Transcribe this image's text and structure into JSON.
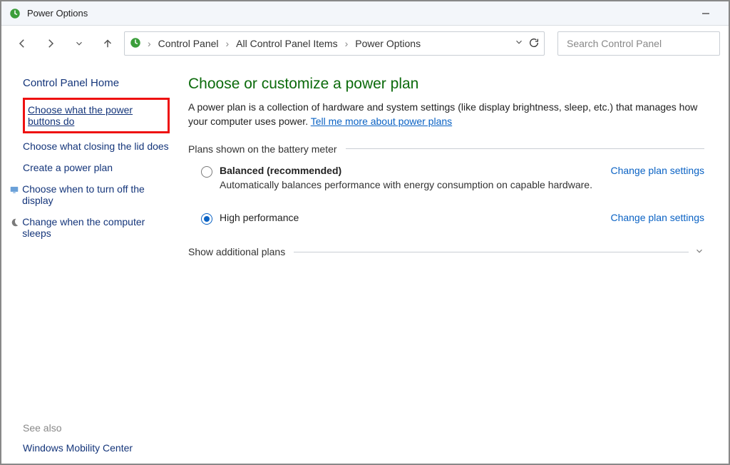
{
  "titlebar": {
    "title": "Power Options"
  },
  "breadcrumb": {
    "seg1": "Control Panel",
    "seg2": "All Control Panel Items",
    "seg3": "Power Options"
  },
  "search": {
    "placeholder": "Search Control Panel"
  },
  "sidebar": {
    "home": "Control Panel Home",
    "items": [
      {
        "label": "Choose what the power buttons do",
        "highlighted": true
      },
      {
        "label": "Choose what closing the lid does"
      },
      {
        "label": "Create a power plan"
      },
      {
        "label": "Choose when to turn off the display",
        "icon": "display"
      },
      {
        "label": "Change when the computer sleeps",
        "icon": "moon"
      }
    ],
    "see_also_label": "See also",
    "see_also_item": "Windows Mobility Center"
  },
  "main": {
    "heading": "Choose or customize a power plan",
    "intro_text": "A power plan is a collection of hardware and system settings (like display brightness, sleep, etc.) that manages how your computer uses power. ",
    "intro_link": "Tell me more about power plans",
    "plans_group_label": "Plans shown on the battery meter",
    "plans": [
      {
        "title": "Balanced (recommended)",
        "desc": "Automatically balances performance with energy consumption on capable hardware.",
        "action": "Change plan settings",
        "selected": false,
        "strong": true
      },
      {
        "title": "High performance",
        "desc": "",
        "action": "Change plan settings",
        "selected": true,
        "strong": false
      }
    ],
    "additional_label": "Show additional plans"
  }
}
